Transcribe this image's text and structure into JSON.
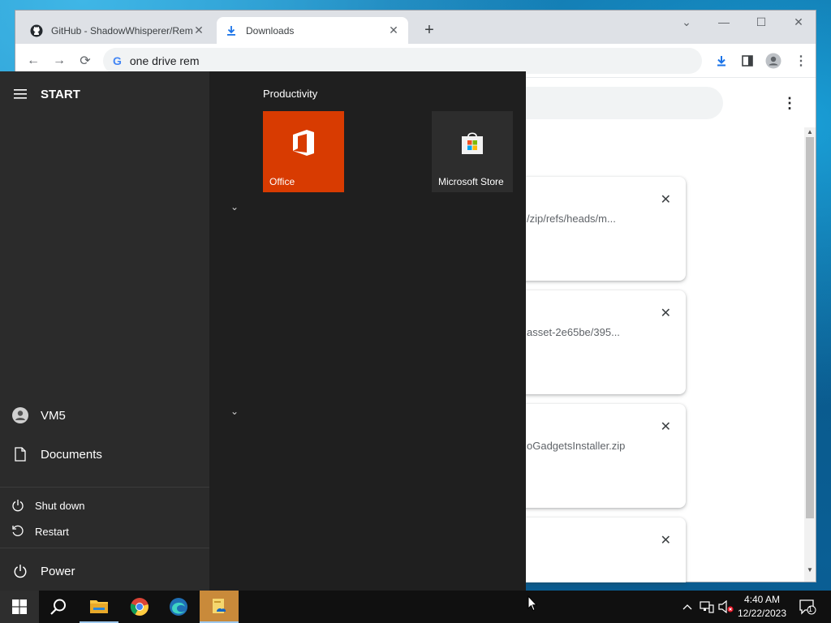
{
  "browser": {
    "tabs": [
      {
        "title": "GitHub - ShadowWhisperer/Rem",
        "icon": "github-icon"
      },
      {
        "title": "Downloads",
        "icon": "download-icon"
      }
    ],
    "address": "one drive rem"
  },
  "downloads": {
    "items": [
      {
        "text": "/zip/refs/heads/m..."
      },
      {
        "text": "asset-2e65be/395..."
      },
      {
        "text": "oGadgetsInstaller.zip"
      },
      {
        "text": ""
      }
    ]
  },
  "start_menu": {
    "title": "START",
    "user": "VM5",
    "documents": "Documents",
    "power_options": {
      "shutdown": "Shut down",
      "restart": "Restart"
    },
    "power": "Power",
    "group": "Productivity",
    "tiles": [
      {
        "label": "Office",
        "color": "#d83b01"
      },
      {
        "label": "Microsoft Store",
        "color": "#2d2d2d"
      }
    ]
  },
  "taskbar": {
    "pinned": [
      "start-icon",
      "search-icon",
      "file-explorer-icon",
      "chrome-icon",
      "edge-icon",
      "onedrive-setup-icon"
    ],
    "clock_time": "4:40 AM",
    "clock_date": "12/22/2023",
    "notification_count": "1"
  }
}
